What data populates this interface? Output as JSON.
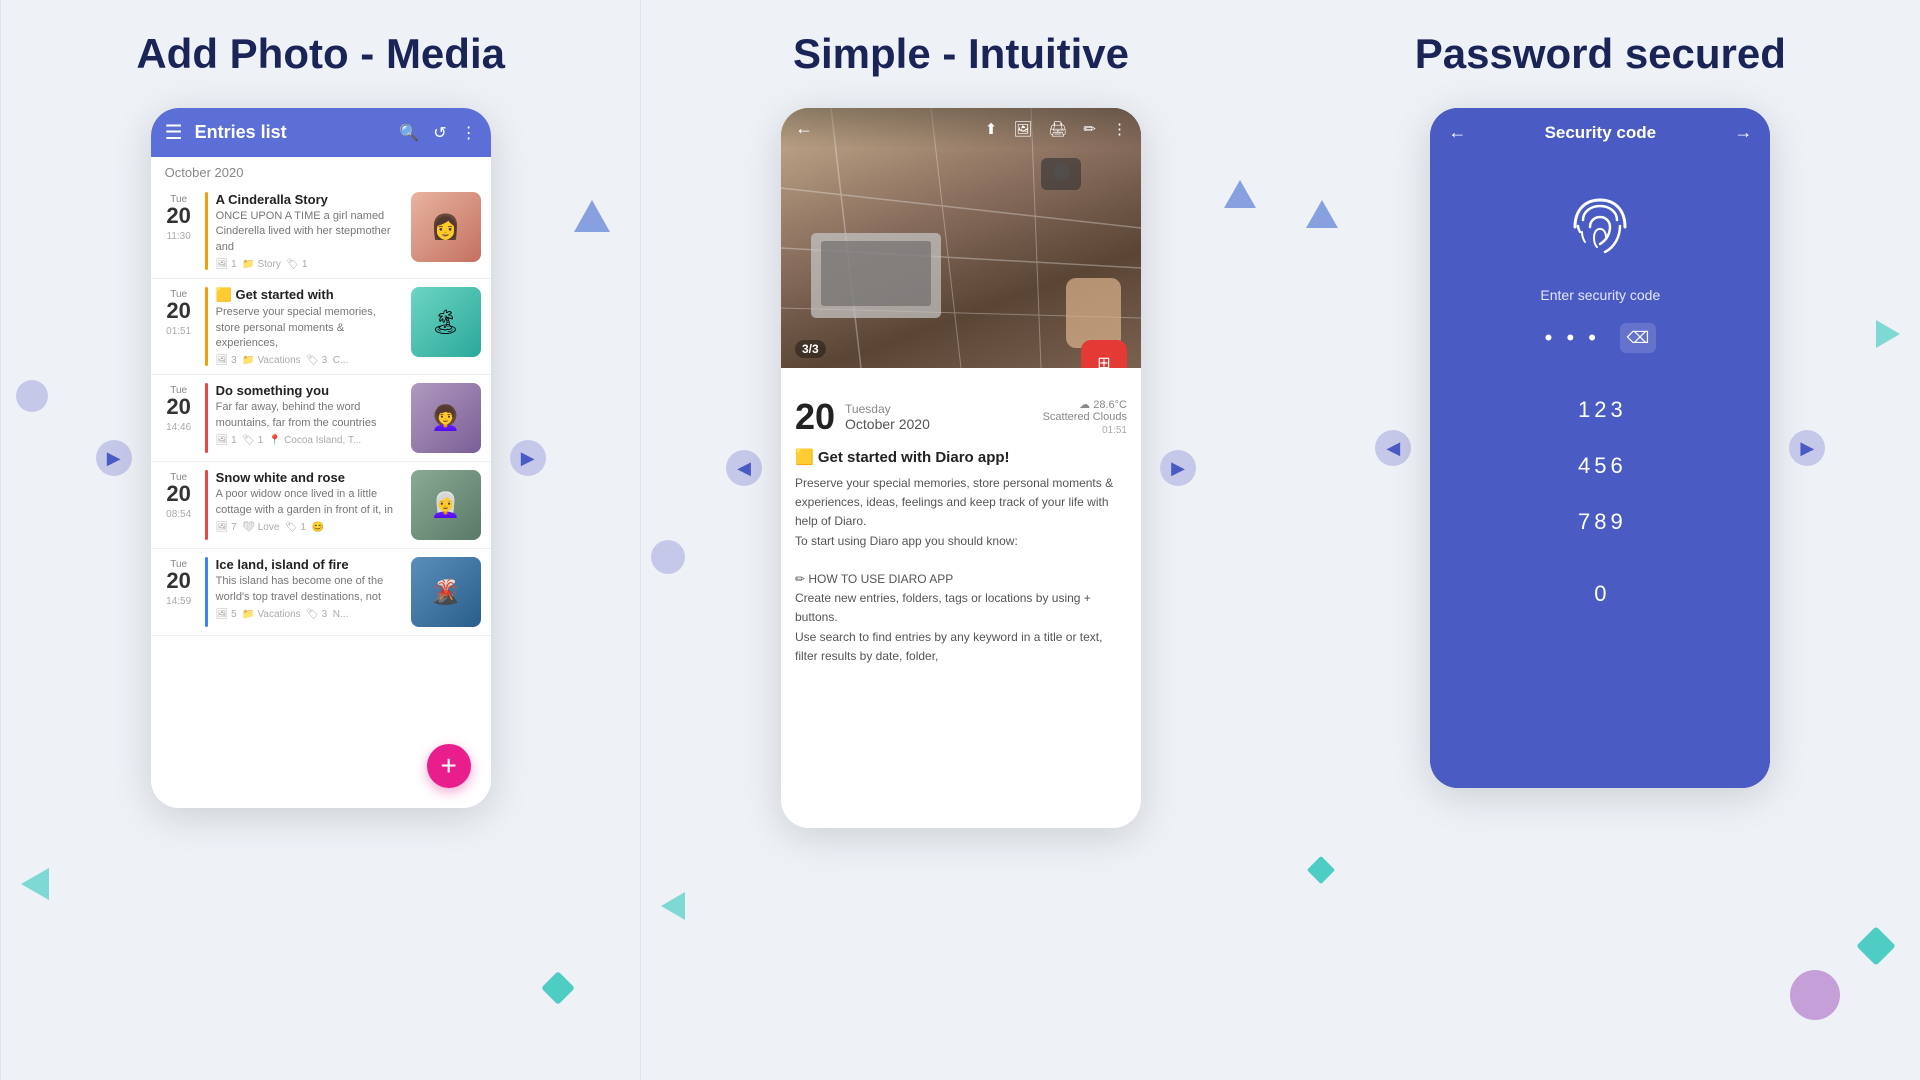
{
  "panels": [
    {
      "id": "add-photo-media",
      "title": "Add Photo - Media",
      "phone": {
        "header": {
          "title": "Entries list",
          "icons": [
            "☰",
            "🔍",
            "↺",
            "⋮"
          ]
        },
        "month": "October 2020",
        "entries": [
          {
            "dow": "Tue",
            "day": "20",
            "time": "11:30",
            "accentColor": "#f59e0b",
            "title": "A Cinderalla Story",
            "body": "ONCE UPON A TIME a girl named Cinderella lived with her stepmother and",
            "meta": "🖼 1  📁 Story  🏷 1",
            "thumbColor": "#e8a090",
            "thumbEmoji": "👩"
          },
          {
            "dow": "Tue",
            "day": "20",
            "time": "01:51",
            "accentColor": "#f59e0b",
            "title": "🟨 Get started with",
            "body": "Preserve your special memories, store personal moments & experiences,",
            "meta": "🖼 3  📁 Vacations  🏷 3  C...",
            "thumbColor": "#6bbfb5",
            "thumbEmoji": "🏝"
          },
          {
            "dow": "Tue",
            "day": "20",
            "time": "14:46",
            "accentColor": "#ef4444",
            "title": "Do something you",
            "body": "Far far away, behind the word mountains, far from the countries",
            "meta": "🖼 1  🏷 1  📍 Cocoa Island, T...",
            "thumbColor": "#9b7fb5",
            "thumbEmoji": "👩‍🦱"
          },
          {
            "dow": "Tue",
            "day": "20",
            "time": "08:54",
            "accentColor": "#ef4444",
            "title": "Snow white and rose",
            "body": "A poor widow once lived in a little cottage with a garden in front of it, in",
            "meta": "🖼 7  ❤ Love  🏷 1  😊",
            "thumbColor": "#7b9b8a",
            "thumbEmoji": "👩‍🦳"
          },
          {
            "dow": "Tue",
            "day": "20",
            "time": "14:59",
            "accentColor": "#3b82f6",
            "title": "Ice land, island of fire",
            "body": "This island has become one of the world's top travel destinations, not",
            "meta": "🖼 5  📁 Vacations  🏷 3  N...",
            "thumbColor": "#4a7bbb",
            "thumbEmoji": "🌋"
          }
        ],
        "fab": "+"
      }
    },
    {
      "id": "simple-intuitive",
      "title": "Simple - Intuitive",
      "phone": {
        "imageCounter": "3/3",
        "day": "20",
        "weekday": "Tuesday",
        "monthYear": "October 2020",
        "weather": "☁ 28.6°C\nScattered Clouds",
        "time": "01:51",
        "entryTitle": "🟨 Get started with Diaro app!",
        "entryText": "Preserve your special memories, store personal moments & experiences, ideas, feelings and keep track of your life with help of Diaro.\nTo start using Diaro app you should know:\n\n✏ HOW TO USE DIARO APP\nCreate new entries, folders, tags or locations by using + buttons.\nUse search to find entries by any keyword in a title or text, filter results by date, folder,"
      }
    },
    {
      "id": "password-secured",
      "title": "Password secured",
      "phone": {
        "header": {
          "title": "Security code",
          "backIcon": "←",
          "forwardIcon": "→"
        },
        "subtitle": "Enter security code",
        "dotsDisplay": "• • •",
        "keys": [
          "1",
          "2",
          "3",
          "4",
          "5",
          "6",
          "7",
          "8",
          "9",
          "0"
        ]
      }
    }
  ]
}
